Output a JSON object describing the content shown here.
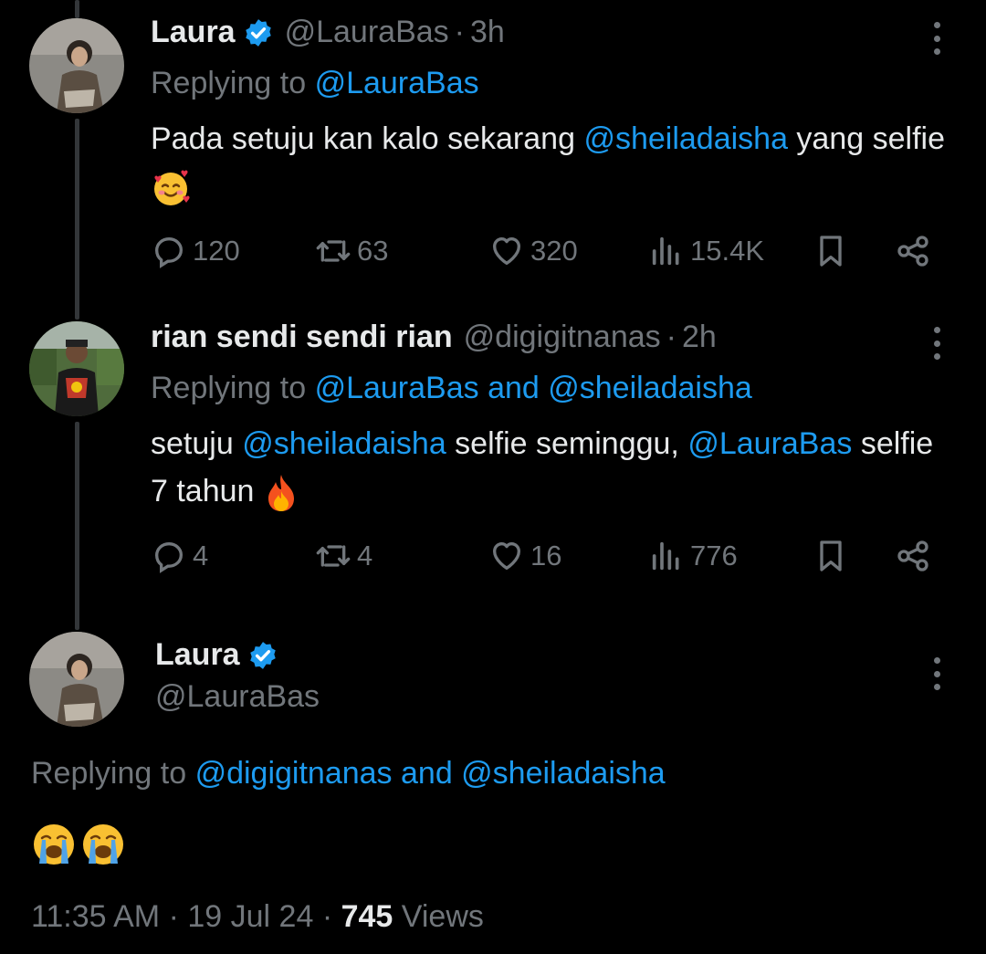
{
  "tweets": [
    {
      "name": "Laura",
      "handle": "@LauraBas",
      "dot": "·",
      "time": "3h",
      "replying_prefix": "Replying to",
      "replying_to": "@LauraBas",
      "text_pre": "Pada setuju kan kalo sekarang ",
      "mention": "@sheiladaisha",
      "text_post": " yang selfie",
      "emoji": "smiling-face-with-hearts",
      "stats": {
        "replies": "120",
        "retweets": "63",
        "likes": "320",
        "views": "15.4K"
      }
    },
    {
      "name": "rian sendi sendi rian",
      "handle": "@digigitnanas",
      "dot": "·",
      "time": "2h",
      "replying_prefix": "Replying to",
      "replying_to": "@LauraBas and @sheiladaisha",
      "text_a": "setuju ",
      "mention_a": "@sheiladaisha",
      "text_b": " selfie seminggu, ",
      "mention_b": "@LauraBas",
      "text_c": " selfie 7 tahun",
      "emoji": "fire",
      "stats": {
        "replies": "4",
        "retweets": "4",
        "likes": "16",
        "views": "776"
      }
    }
  ],
  "main": {
    "name": "Laura",
    "handle": "@LauraBas",
    "replying_prefix": "Replying to",
    "replying_to": "@digigitnanas and @sheiladaisha",
    "emoji": "loudly-crying-face x2",
    "time": "11:35 AM",
    "dot": "·",
    "date": "19 Jul 24",
    "views_count": "745",
    "views_label": "Views"
  },
  "colors": {
    "background": "#000000",
    "text": "#e7e9ea",
    "muted": "#71767b",
    "link": "#1d9bf0",
    "verified": "#1d9bf0"
  }
}
